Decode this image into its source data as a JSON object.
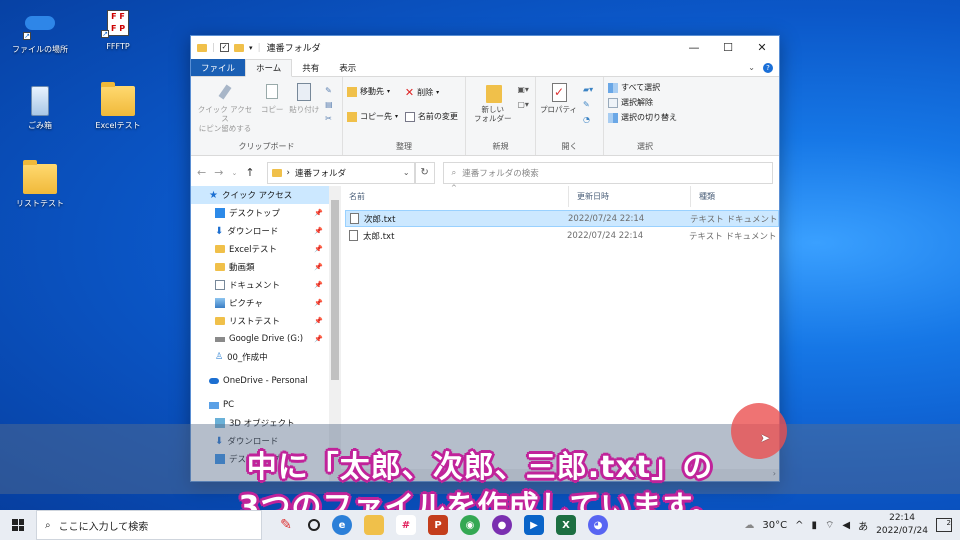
{
  "desktop": {
    "icons": [
      {
        "label": "ファイルの場所",
        "icon": "onedrive-folder-icon"
      },
      {
        "label": "FFFTP",
        "icon": "ffftp-icon"
      },
      {
        "label": "ごみ箱",
        "icon": "recycle-bin-icon"
      },
      {
        "label": "Excelテスト",
        "icon": "folder-icon"
      },
      {
        "label": "リストテスト",
        "icon": "folder-icon"
      }
    ]
  },
  "window": {
    "title": "連番フォルダ",
    "controls": {
      "minimize": "—",
      "maximize": "☐",
      "close": "✕"
    },
    "tabs": {
      "file": "ファイル",
      "home": "ホーム",
      "share": "共有",
      "view": "表示"
    },
    "ribbon": {
      "clipboard": {
        "name": "クリップボード",
        "pin": "クイック アクセス\nにピン留めする",
        "copy": "コピー",
        "paste": "貼り付け"
      },
      "organize": {
        "name": "整理",
        "move_to": "移動先",
        "copy_to": "コピー先",
        "delete": "削除",
        "rename": "名前の変更"
      },
      "new": {
        "name": "新規",
        "new_folder": "新しい\nフォルダー"
      },
      "open": {
        "name": "開く",
        "properties": "プロパティ"
      },
      "select": {
        "name": "選択",
        "select_all": "すべて選択",
        "select_none": "選択解除",
        "invert": "選択の切り替え"
      }
    },
    "address": {
      "path": "連番フォルダ",
      "separator": "›"
    },
    "search": {
      "placeholder": "連番フォルダの検索"
    },
    "nav": {
      "quick_access": "クイック アクセス",
      "items": [
        {
          "label": "デスクトップ",
          "pinned": true
        },
        {
          "label": "ダウンロード",
          "pinned": true
        },
        {
          "label": "Excelテスト",
          "pinned": true
        },
        {
          "label": "動画類",
          "pinned": true
        },
        {
          "label": "ドキュメント",
          "pinned": true
        },
        {
          "label": "ピクチャ",
          "pinned": true
        },
        {
          "label": "リストテスト",
          "pinned": true
        },
        {
          "label": "Google Drive (G:)",
          "pinned": true
        },
        {
          "label": "00_作成中",
          "pinned": false
        }
      ],
      "onedrive": "OneDrive - Personal",
      "pc": "PC",
      "pc_items": [
        {
          "label": "3D オブジェクト"
        },
        {
          "label": "ダウンロード"
        },
        {
          "label": "デスクトップ"
        }
      ]
    },
    "columns": {
      "name": "名前",
      "modified": "更新日時",
      "type": "種類"
    },
    "files": [
      {
        "name": "次郎.txt",
        "modified": "2022/07/24 22:14",
        "type": "テキスト ドキュメント",
        "selected": true
      },
      {
        "name": "太郎.txt",
        "modified": "2022/07/24 22:14",
        "type": "テキスト ドキュメント",
        "selected": false
      }
    ]
  },
  "caption": {
    "line1": "中に「太郎、次郎、三郎.txt」の",
    "line2": "3つのファイルを作成しています。"
  },
  "taskbar": {
    "search_placeholder": "ここに入力して検索",
    "temperature": "30°C",
    "ime": "あ",
    "time": "22:14",
    "date": "2022/07/24",
    "notifications": "2"
  }
}
